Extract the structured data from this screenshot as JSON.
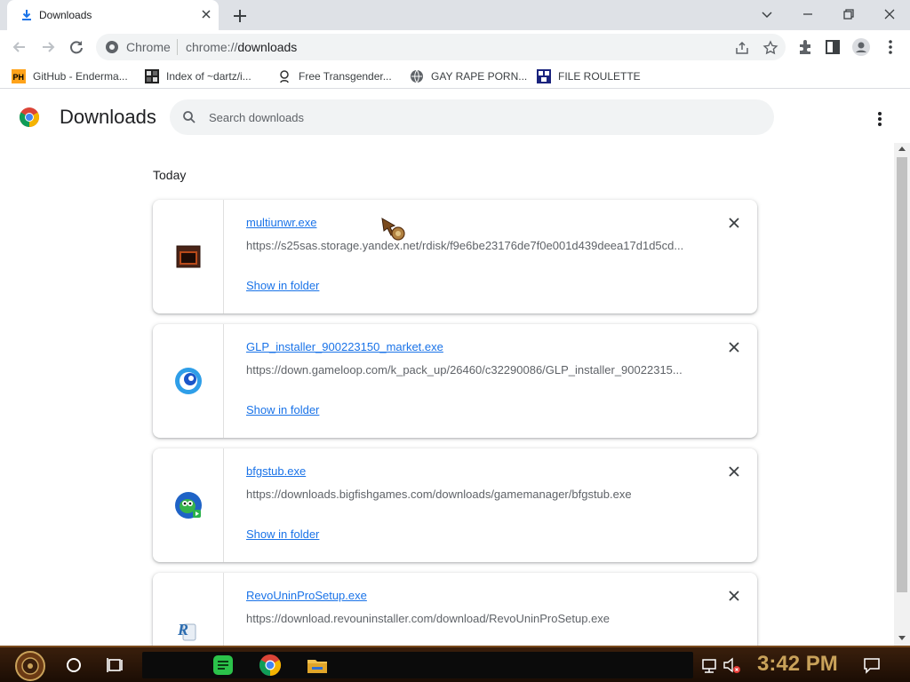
{
  "browser": {
    "tab_title": "Downloads",
    "url_chip": "Chrome",
    "url_prefix": "chrome://",
    "url_path": "downloads"
  },
  "bookmarks": [
    {
      "label": "GitHub - Enderma...",
      "icon": "ph-icon"
    },
    {
      "label": "Index of ~dartz/i...",
      "icon": "index-icon"
    },
    {
      "label": "Free Transgender...",
      "icon": "bookmark-site-icon"
    },
    {
      "label": "GAY RAPE PORN...",
      "icon": "globe-icon"
    },
    {
      "label": "FILE ROULETTE",
      "icon": "mft-icon"
    }
  ],
  "page": {
    "title": "Downloads",
    "search_placeholder": "Search downloads",
    "section": "Today"
  },
  "downloads": [
    {
      "name": "multiunwr.exe",
      "url": "https://s25sas.storage.yandex.net/rdisk/f9e6be23176de7f0e001d439deea17d1d5cd...",
      "action": "Show in folder",
      "icon": "exe-window-icon"
    },
    {
      "name": "GLP_installer_900223150_market.exe",
      "url": "https://down.gameloop.com/k_pack_up/26460/c32290086/GLP_installer_90022315...",
      "action": "Show in folder",
      "icon": "gameloop-icon"
    },
    {
      "name": "bfgstub.exe",
      "url": "https://downloads.bigfishgames.com/downloads/gamemanager/bfgstub.exe",
      "action": "Show in folder",
      "icon": "bigfish-icon"
    },
    {
      "name": "RevoUninProSetup.exe",
      "url": "https://download.revouninstaller.com/download/RevoUninProSetup.exe",
      "action": "",
      "icon": "revo-icon"
    }
  ],
  "taskbar": {
    "clock": "3:42 PM"
  },
  "colors": {
    "link": "#1a73e8",
    "tabstrip": "#dee1e6",
    "taskbar": "#2a1508",
    "clock": "#c9a25a"
  }
}
